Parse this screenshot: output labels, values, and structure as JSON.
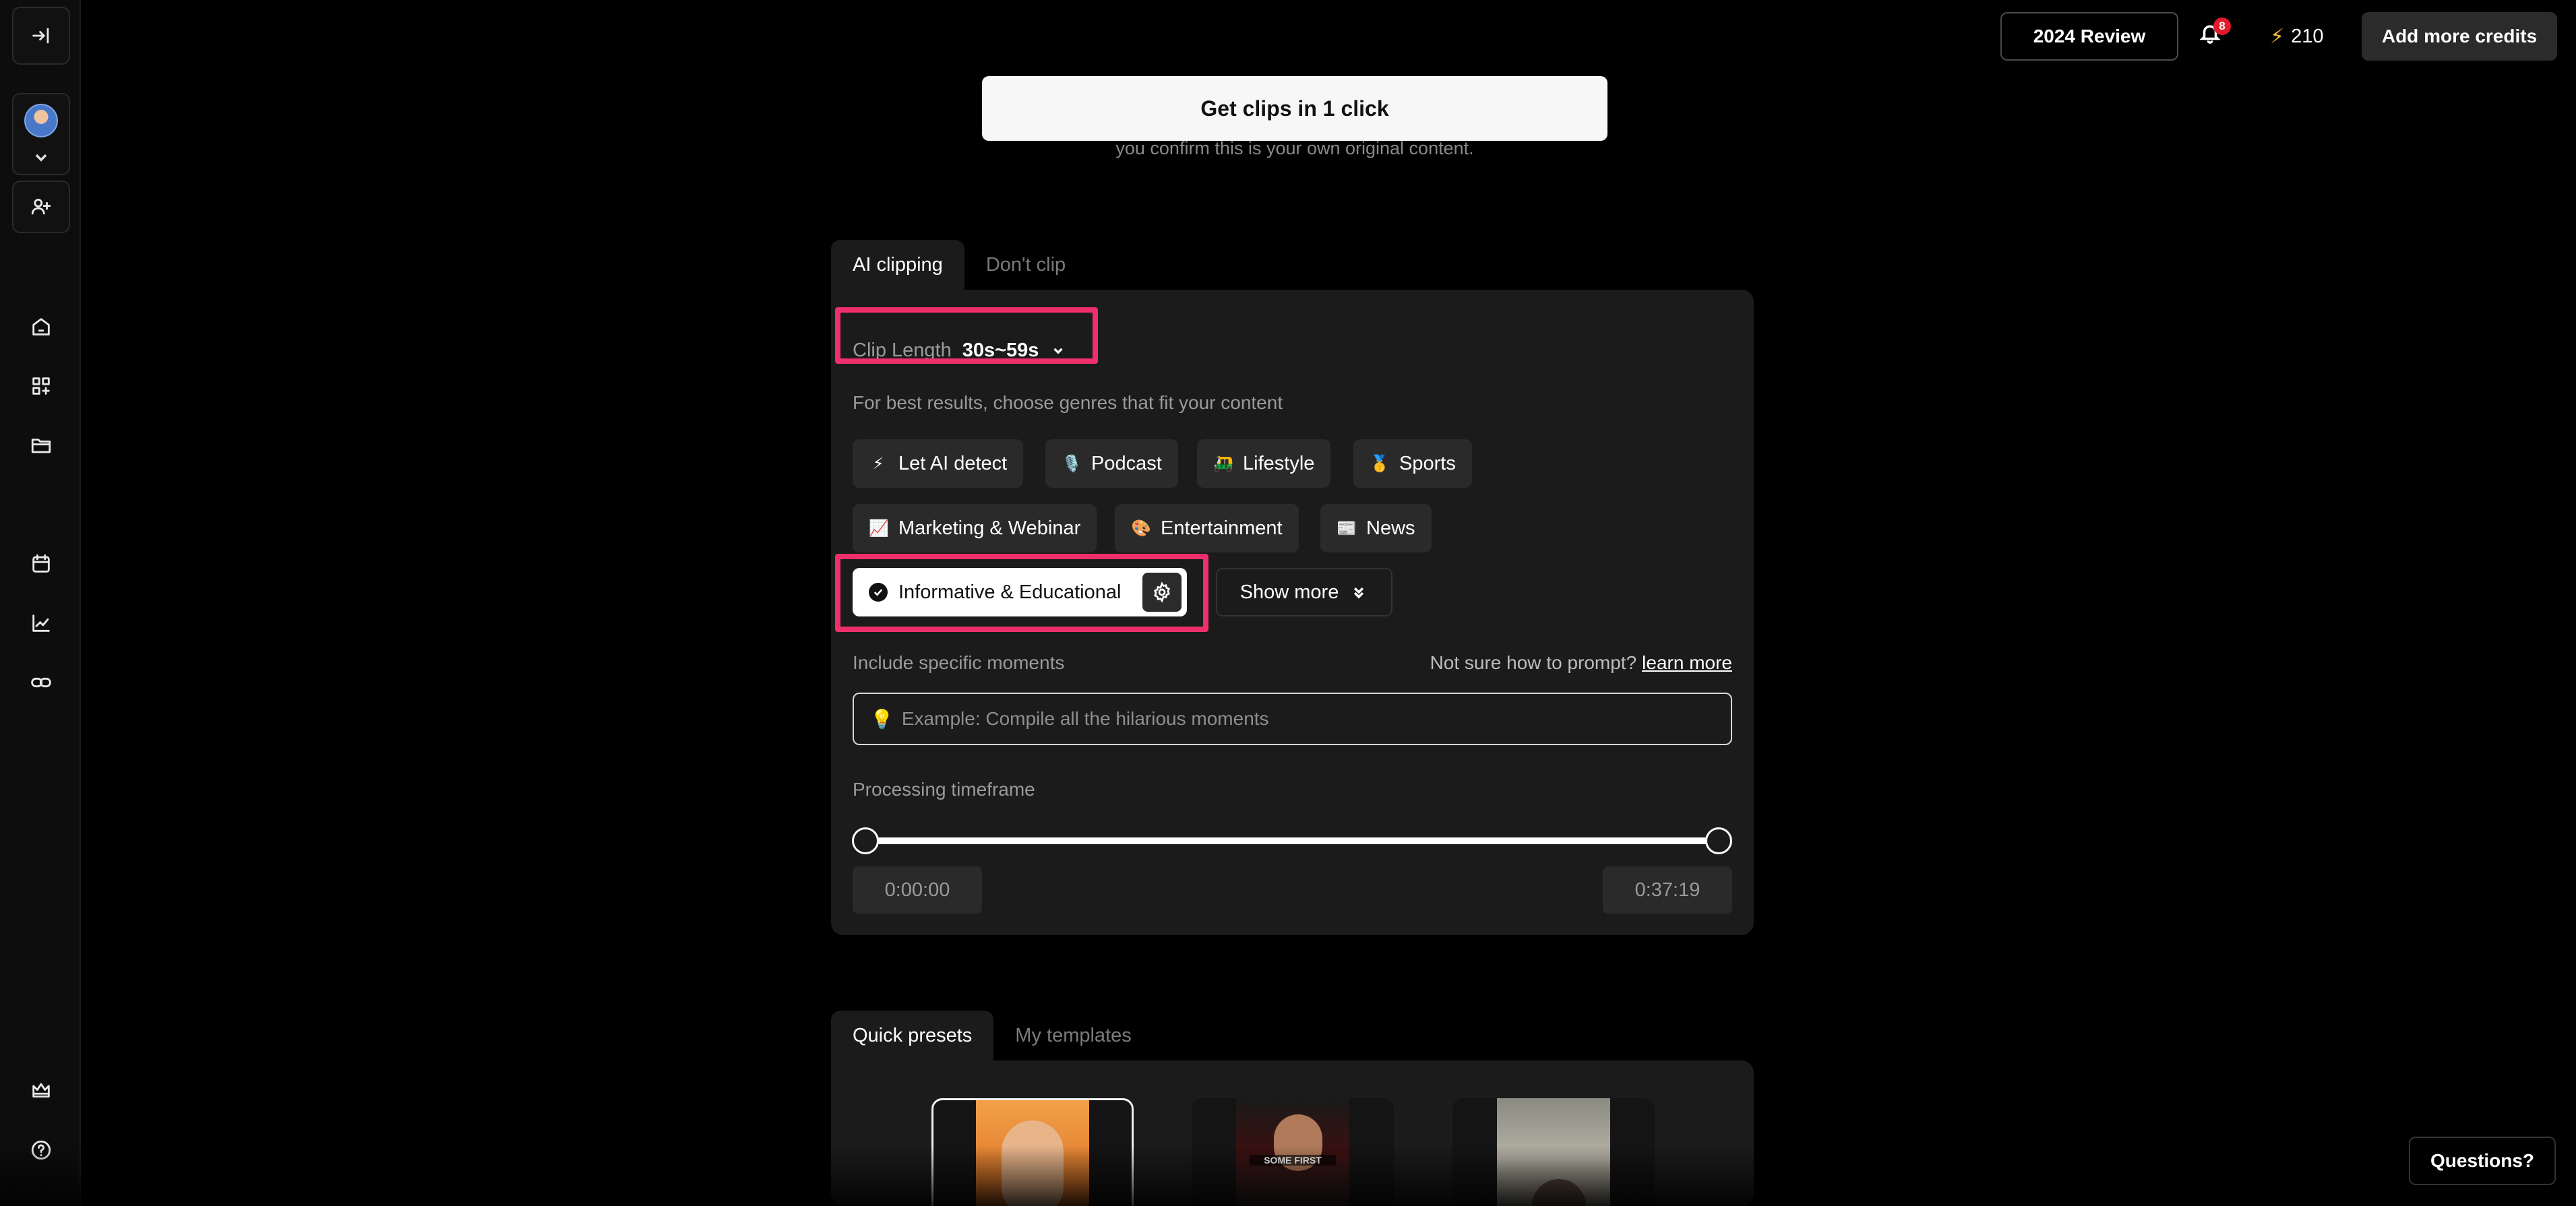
{
  "topbar": {
    "review_label": "2024 Review",
    "notification_count": "8",
    "credits": "210",
    "add_credits_label": "Add more credits"
  },
  "main": {
    "get_clips_label": "Get clips in 1 click",
    "confirm_text": "you confirm this is your own original content.",
    "clip_tabs": [
      "AI clipping",
      "Don't clip"
    ],
    "clip_length": {
      "label": "Clip Length",
      "value": "30s~59s"
    },
    "genre_hint": "For best results, choose genres that fit your content",
    "genres": [
      {
        "emoji": "⚡",
        "label": "Let AI detect"
      },
      {
        "emoji": "🎙️",
        "label": "Podcast"
      },
      {
        "emoji": "🛺",
        "label": "Lifestyle"
      },
      {
        "emoji": "🥇",
        "label": "Sports"
      },
      {
        "emoji": "📈",
        "label": "Marketing & Webinar"
      },
      {
        "emoji": "🎨",
        "label": "Entertainment"
      },
      {
        "emoji": "📰",
        "label": "News"
      }
    ],
    "selected_genre": "Informative & Educational",
    "show_more_label": "Show more",
    "moments": {
      "label": "Include specific moments",
      "help_text": "Not sure how to prompt?",
      "help_link": "learn more",
      "placeholder": "Example: Compile all the hilarious moments"
    },
    "processing": {
      "label": "Processing timeframe",
      "start": "0:00:00",
      "end": "0:37:19",
      "range_fraction": [
        0,
        1
      ]
    },
    "preset_tabs": [
      "Quick presets",
      "My templates"
    ],
    "presets": [
      {
        "caption": ""
      },
      {
        "caption": "SOME FIRST"
      },
      {
        "caption": ""
      }
    ]
  },
  "questions_label": "Questions?",
  "colors": {
    "accent_highlight": "#ee2f6b",
    "bolt": "#f6c23a",
    "badge": "#e21a2c",
    "panel_bg": "#1b1b1c"
  },
  "icons": {
    "sidebar": [
      "collapse-sidebar-icon",
      "add-user-icon",
      "home-icon",
      "apps-icon",
      "folder-icon",
      "calendar-icon",
      "analytics-icon",
      "link-icon",
      "crown-icon",
      "help-icon"
    ]
  }
}
